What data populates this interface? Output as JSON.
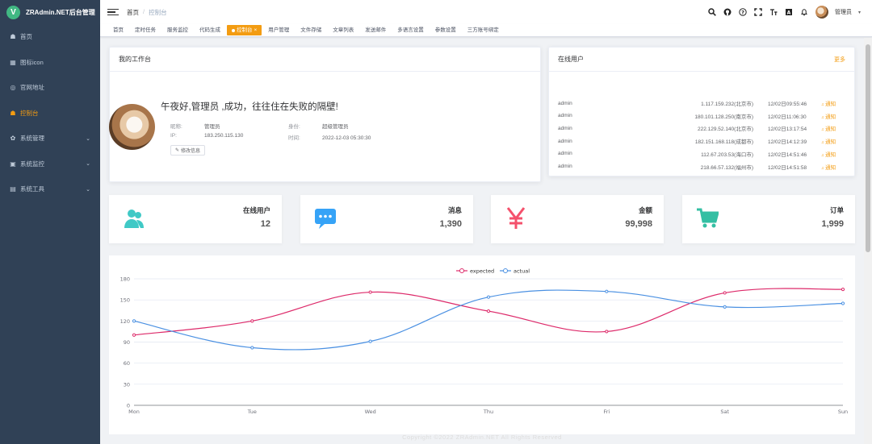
{
  "brand": {
    "logo_letter": "V",
    "title": "ZRAdmin.NET后台管理"
  },
  "sidebar": {
    "items": [
      {
        "label": "首页",
        "icon": "dashboard-icon",
        "glyph": "☗",
        "expandable": false
      },
      {
        "label": "图标icon",
        "icon": "grid-icon",
        "glyph": "▦",
        "expandable": false
      },
      {
        "label": "官网地址",
        "icon": "globe-icon",
        "glyph": "◎",
        "expandable": false
      },
      {
        "label": "控制台",
        "icon": "dashboard-icon",
        "glyph": "☗",
        "expandable": false,
        "active": true
      },
      {
        "label": "系统管理",
        "icon": "gear-icon",
        "glyph": "✿",
        "expandable": true
      },
      {
        "label": "系统监控",
        "icon": "monitor-icon",
        "glyph": "▣",
        "expandable": true
      },
      {
        "label": "系统工具",
        "icon": "toolbox-icon",
        "glyph": "▤",
        "expandable": true
      }
    ]
  },
  "navbar": {
    "breadcrumb": [
      "首页",
      "控制台"
    ],
    "breadcrumb_separator": "/",
    "user_name": "管理员",
    "icons": [
      "search-icon",
      "github-icon",
      "help-icon",
      "fullscreen-icon",
      "font-size-icon",
      "language-icon",
      "bell-icon"
    ]
  },
  "tags": [
    "首页",
    "定时任务",
    "服务监控",
    "代码生成",
    "控制台",
    "用户管理",
    "文件存储",
    "文章列表",
    "发送邮件",
    "多语言设置",
    "参数设置",
    "三方账号绑定"
  ],
  "active_tag": "控制台",
  "workbench": {
    "title": "我的工作台",
    "greeting": "午夜好,管理员 ,成功，往往住在失败的隔壁!",
    "nickname_label": "昵称:",
    "nickname": "管理员",
    "role_label": "身份:",
    "role": "超级管理员",
    "ip_label": "IP:",
    "ip": "183.250.115.130",
    "time_label": "时间:",
    "time": "2022-12-03 05:30:30",
    "edit_label": "修改信息"
  },
  "online": {
    "title": "在线用户",
    "more": "更多",
    "notify_label": "通知",
    "rows": [
      {
        "user": "admin",
        "ip": "1.117.159.232(北京市)",
        "time": "12/02日09:55:46"
      },
      {
        "user": "admin",
        "ip": "180.101.128.250(南京市)",
        "time": "12/02日11:06:30"
      },
      {
        "user": "admin",
        "ip": "222.129.52.140(北京市)",
        "time": "12/02日13:17:54"
      },
      {
        "user": "admin",
        "ip": "182.151.168.118(成都市)",
        "time": "12/02日14:12:39"
      },
      {
        "user": "admin",
        "ip": "112.67.203.53(海口市)",
        "time": "12/02日14:51:46"
      },
      {
        "user": "admin",
        "ip": "218.66.57.132(福州市)",
        "time": "12/02日14:51:58"
      }
    ]
  },
  "stats": [
    {
      "label": "在线用户",
      "value": "12",
      "icon": "users-icon",
      "color": "#40c9c6"
    },
    {
      "label": "消息",
      "value": "1,390",
      "icon": "message-icon",
      "color": "#36a3f7"
    },
    {
      "label": "金额",
      "value": "99,998",
      "icon": "yen-icon",
      "color": "#f4516c"
    },
    {
      "label": "订单",
      "value": "1,999",
      "icon": "shopping-cart-icon",
      "color": "#34bfa3"
    }
  ],
  "chart_data": {
    "type": "line",
    "categories": [
      "Mon",
      "Tue",
      "Wed",
      "Thu",
      "Fri",
      "Sat",
      "Sun"
    ],
    "series": [
      {
        "name": "expected",
        "values": [
          100,
          120,
          161,
          134,
          105,
          160,
          165
        ],
        "color": "#dd2a6a"
      },
      {
        "name": "actual",
        "values": [
          120,
          82,
          91,
          154,
          162,
          140,
          145
        ],
        "color": "#4a90e2"
      }
    ],
    "ylim": [
      0,
      180
    ],
    "yticks": [
      0,
      30,
      60,
      90,
      120,
      150,
      180
    ],
    "legend_position": "top",
    "smooth": true
  },
  "footer": "Copyright ©2022 ZRAdmin.NET All Rights Reserved"
}
